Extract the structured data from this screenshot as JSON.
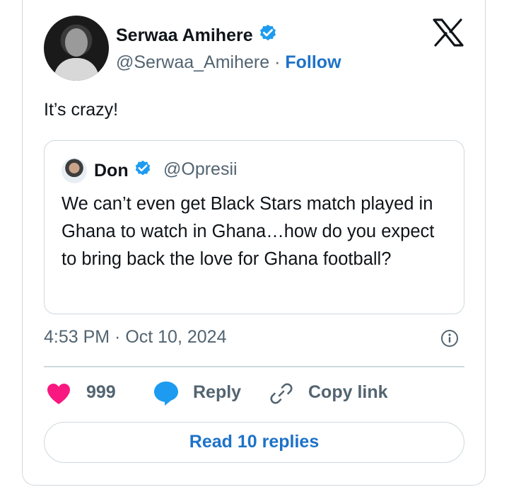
{
  "author": {
    "name": "Serwaa Amihere",
    "handle": "@Serwaa_Amihere",
    "separator": "·",
    "follow_label": "Follow"
  },
  "tweet": {
    "text": "It’s crazy!",
    "timestamp": "4:53 PM · Oct 10, 2024"
  },
  "quoted": {
    "name": "Don",
    "handle": "@Opresii",
    "text": "We can’t even get Black Stars match played in Ghana to watch in Ghana…how do you expect to bring back the love for Ghana football?"
  },
  "actions": {
    "likes": "999",
    "reply_label": "Reply",
    "copy_label": "Copy link",
    "read_replies_label": "Read 10 replies"
  },
  "colors": {
    "accent": "#1d72c9",
    "verified": "#1d9bf0",
    "heart": "#f91880",
    "secondary_text": "#536471",
    "border": "#cfd9de"
  },
  "icons": [
    "verified-badge-icon",
    "x-logo-icon",
    "info-icon",
    "heart-icon",
    "reply-bubble-icon",
    "link-icon"
  ]
}
